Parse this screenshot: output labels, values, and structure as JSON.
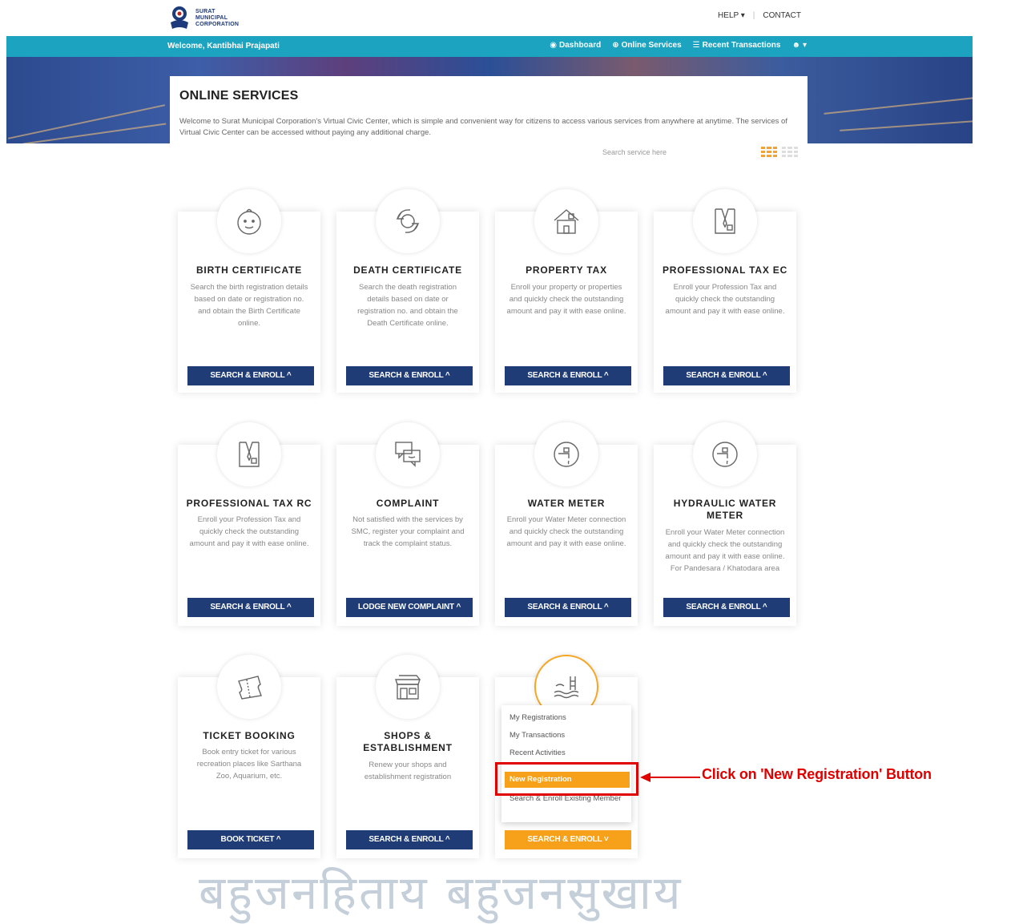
{
  "header": {
    "logo_lines": [
      "SURAT",
      "MUNICIPAL",
      "CORPORATION"
    ],
    "help_label": "HELP ▾",
    "contact_label": "CONTACT"
  },
  "navbar": {
    "welcome": "Welcome, Kantibhai Prajapati",
    "links": [
      {
        "icon": "dashboard-icon",
        "label": "Dashboard"
      },
      {
        "icon": "globe-icon",
        "label": "Online Services"
      },
      {
        "icon": "transactions-icon",
        "label": "Recent Transactions"
      }
    ],
    "user_menu_label": "▾"
  },
  "intro": {
    "title": "ONLINE SERVICES",
    "text": "Welcome to Surat Municipal Corporation's Virtual Civic Center, which is simple and convenient way for citizens to access various services from anywhere at anytime. The services of Virtual Civic Center can be accessed without paying any additional charge.",
    "search_placeholder": "Search service here"
  },
  "cards": [
    {
      "title": "BIRTH CERTIFICATE",
      "desc": "Search the birth registration details based on date or registration no. and obtain the Birth Certificate online.",
      "button": "SEARCH & ENROLL ^"
    },
    {
      "title": "DEATH CERTIFICATE",
      "desc": "Search the death registration details based on date or registration no. and obtain the Death Certificate online.",
      "button": "SEARCH & ENROLL ^"
    },
    {
      "title": "PROPERTY TAX",
      "desc": "Enroll your property or properties and quickly check the outstanding amount and pay it with ease online.",
      "button": "SEARCH & ENROLL ^"
    },
    {
      "title": "PROFESSIONAL TAX EC",
      "desc": "Enroll your Profession Tax and quickly check the outstanding amount and pay it with ease online.",
      "button": "SEARCH & ENROLL ^"
    },
    {
      "title": "PROFESSIONAL TAX RC",
      "desc": "Enroll your Profession Tax and quickly check the outstanding amount and pay it with ease online.",
      "button": "SEARCH & ENROLL ^"
    },
    {
      "title": "COMPLAINT",
      "desc": "Not satisfied with the services by SMC, register your complaint and track the complaint status.",
      "button": "LODGE NEW COMPLAINT ^"
    },
    {
      "title": "WATER METER",
      "desc": "Enroll your Water Meter connection and quickly check the outstanding amount and pay it with ease online.",
      "button": "SEARCH & ENROLL ^"
    },
    {
      "title": "HYDRAULIC WATER METER",
      "desc": "Enroll your Water Meter connection and quickly check the outstanding amount and pay it with ease online. For Pandesara / Khatodara area",
      "button": "SEARCH & ENROLL ^"
    },
    {
      "title": "TICKET BOOKING",
      "desc": "Book entry ticket for various recreation places like Sarthana Zoo, Aquarium, etc.",
      "button": "BOOK TICKET ^"
    },
    {
      "title": "SHOPS & ESTABLISHMENT",
      "desc": "Renew your shops and establishment registration",
      "button": "SEARCH & ENROLL ^"
    },
    {
      "title": "",
      "desc": "",
      "button": "SEARCH & ENROLL ˅"
    }
  ],
  "dropdown": {
    "items": [
      "My Registrations",
      "My Transactions",
      "Recent Activities",
      "New Registration",
      "Search & Enroll Existing Member"
    ]
  },
  "annotation": "Click on 'New Registration' Button",
  "motto": "बहुजनहिताय बहुजनसुखाय",
  "colors": {
    "navbar": "#1ca3c0",
    "button": "#1f3c77",
    "accent": "#f7a11a",
    "annotation": "#e00000"
  }
}
